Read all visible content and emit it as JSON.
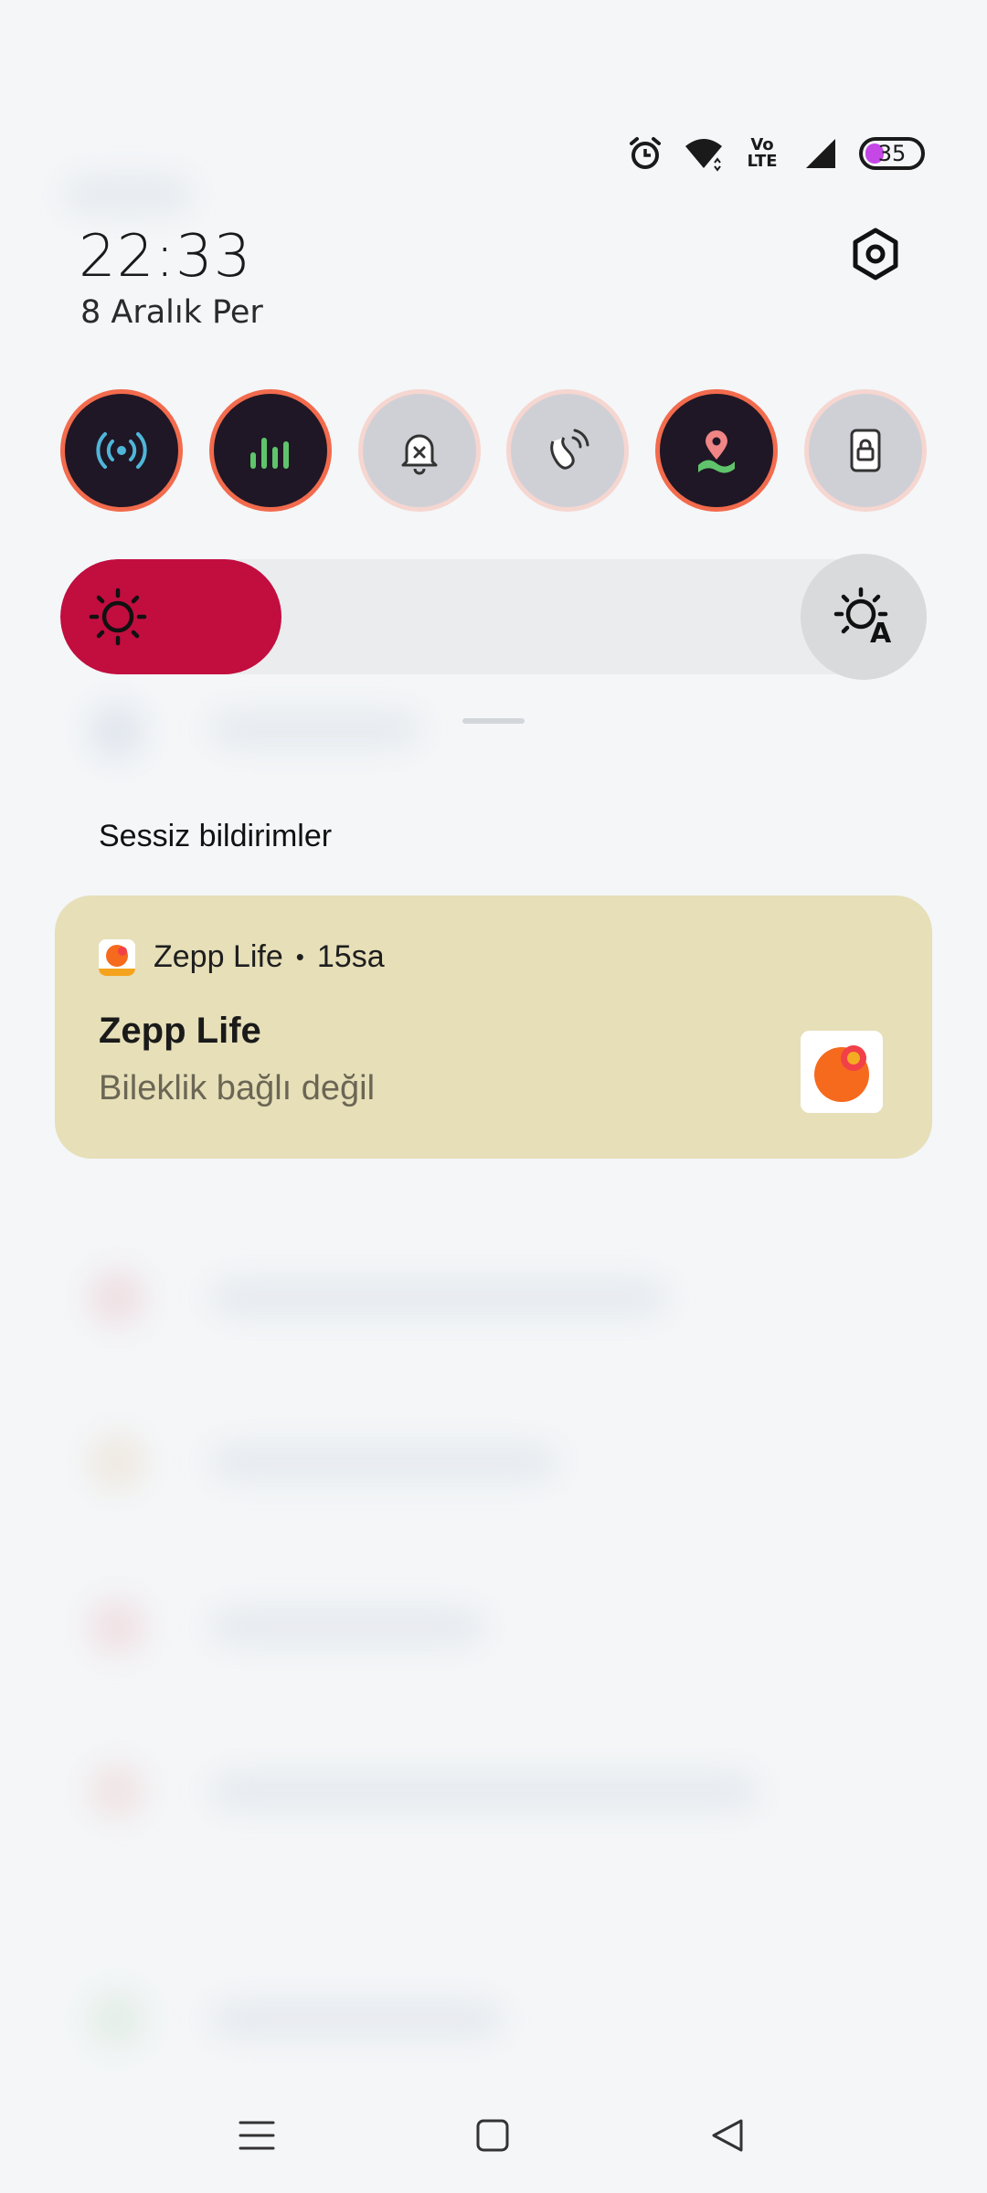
{
  "status_bar": {
    "icons": [
      "alarm-icon",
      "wifi-icon",
      "volte-icon",
      "signal-icon"
    ],
    "volte_line1": "Vo",
    "volte_line2": "LTE",
    "battery_level": "35",
    "battery_fraction": 0.35,
    "battery_color": "#c447e6"
  },
  "header": {
    "time": "22:33",
    "date": "8 Aralık Per"
  },
  "quick_toggles": [
    {
      "icon": "hotspot-icon",
      "state": "on"
    },
    {
      "icon": "data-usage-icon",
      "state": "on"
    },
    {
      "icon": "dnd-bell-icon",
      "state": "off"
    },
    {
      "icon": "nfc-icon",
      "state": "off"
    },
    {
      "icon": "location-icon",
      "state": "on"
    },
    {
      "icon": "lock-screen-icon",
      "state": "off"
    }
  ],
  "brightness": {
    "level_fraction": 0.255,
    "fill_color": "#c20d3f",
    "auto_label": "A"
  },
  "notifications": {
    "section_label": "Sessiz bildirimler",
    "items": [
      {
        "app_name": "Zepp Life",
        "separator": "•",
        "time": "15sa",
        "title": "Zepp Life",
        "text": "Bileklik bağlı değil"
      }
    ]
  },
  "colors": {
    "background": "#f4f6f8",
    "card": "#e6dfb8",
    "toggle_on": "#1f1725",
    "toggle_ring": "#f26b4d"
  },
  "navigation": [
    "menu-icon",
    "home-icon",
    "back-icon"
  ]
}
